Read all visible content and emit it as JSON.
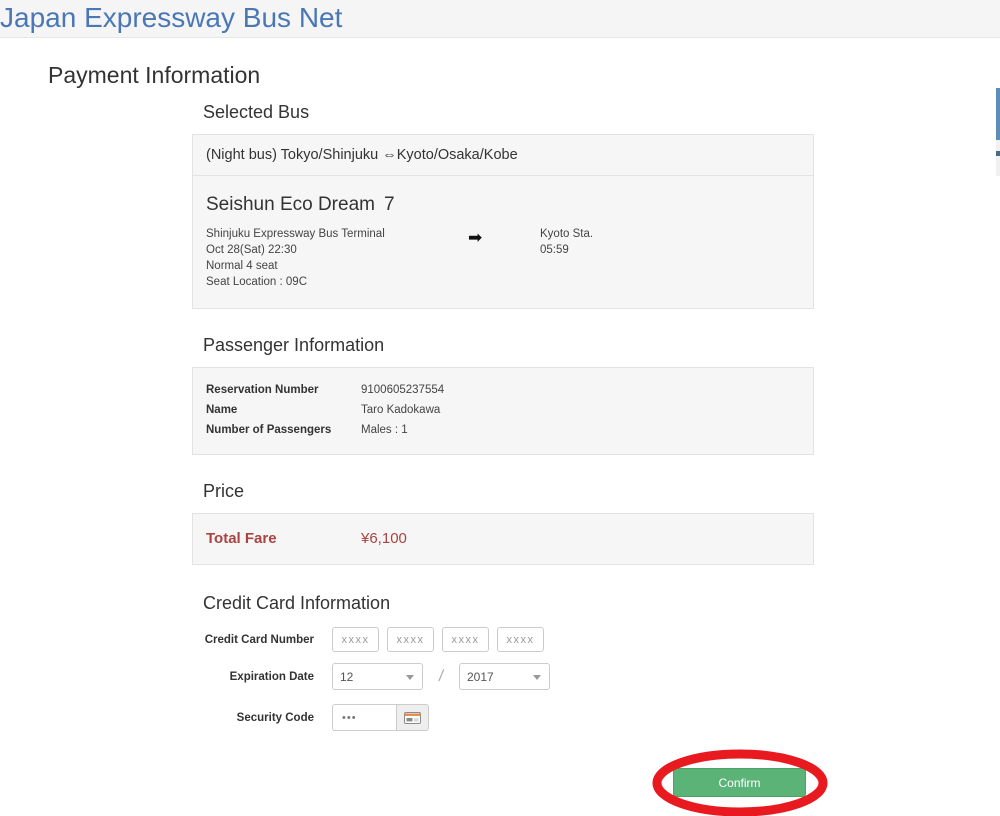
{
  "header": {
    "site_title": "Japan Expressway Bus Net"
  },
  "page": {
    "title": "Payment Information"
  },
  "selected_bus": {
    "section_title": "Selected Bus",
    "route": "(Night bus) Tokyo/Shinjuku ⇔Kyoto/Osaka/Kobe",
    "bus_name": "Seishun Eco Dream",
    "bus_number": "7",
    "arrow_icon": "➡",
    "departure": {
      "place": "Shinjuku Expressway Bus Terminal",
      "datetime": "Oct 28(Sat) 22:30",
      "seat_type": "Normal 4 seat",
      "seat_location": "Seat Location : 09C"
    },
    "arrival": {
      "place": "Kyoto Sta.",
      "time": "05:59"
    }
  },
  "passenger": {
    "section_title": "Passenger Information",
    "rows": [
      {
        "key": "Reservation Number",
        "value": "9100605237554"
      },
      {
        "key": "Name",
        "value": "Taro Kadokawa"
      },
      {
        "key": "Number of Passengers",
        "value": "Males : 1"
      }
    ]
  },
  "price": {
    "section_title": "Price",
    "label": "Total Fare",
    "value": "¥6,100",
    "color": "#a94442"
  },
  "credit_card": {
    "section_title": "Credit Card Information",
    "number_label": "Credit Card Number",
    "number_placeholder": "xxxx",
    "number_groups": [
      "xxxx",
      "xxxx",
      "xxxx",
      "xxxx"
    ],
    "expiration_label": "Expiration Date",
    "expiration_month": "12",
    "expiration_year": "2017",
    "separator": "/",
    "security_label": "Security Code",
    "security_value": "•••",
    "security_icon": "credit-card-icon"
  },
  "actions": {
    "confirm_label": "Confirm",
    "confirm_color": "#5cb377",
    "annotation_color": "#e8191f"
  }
}
